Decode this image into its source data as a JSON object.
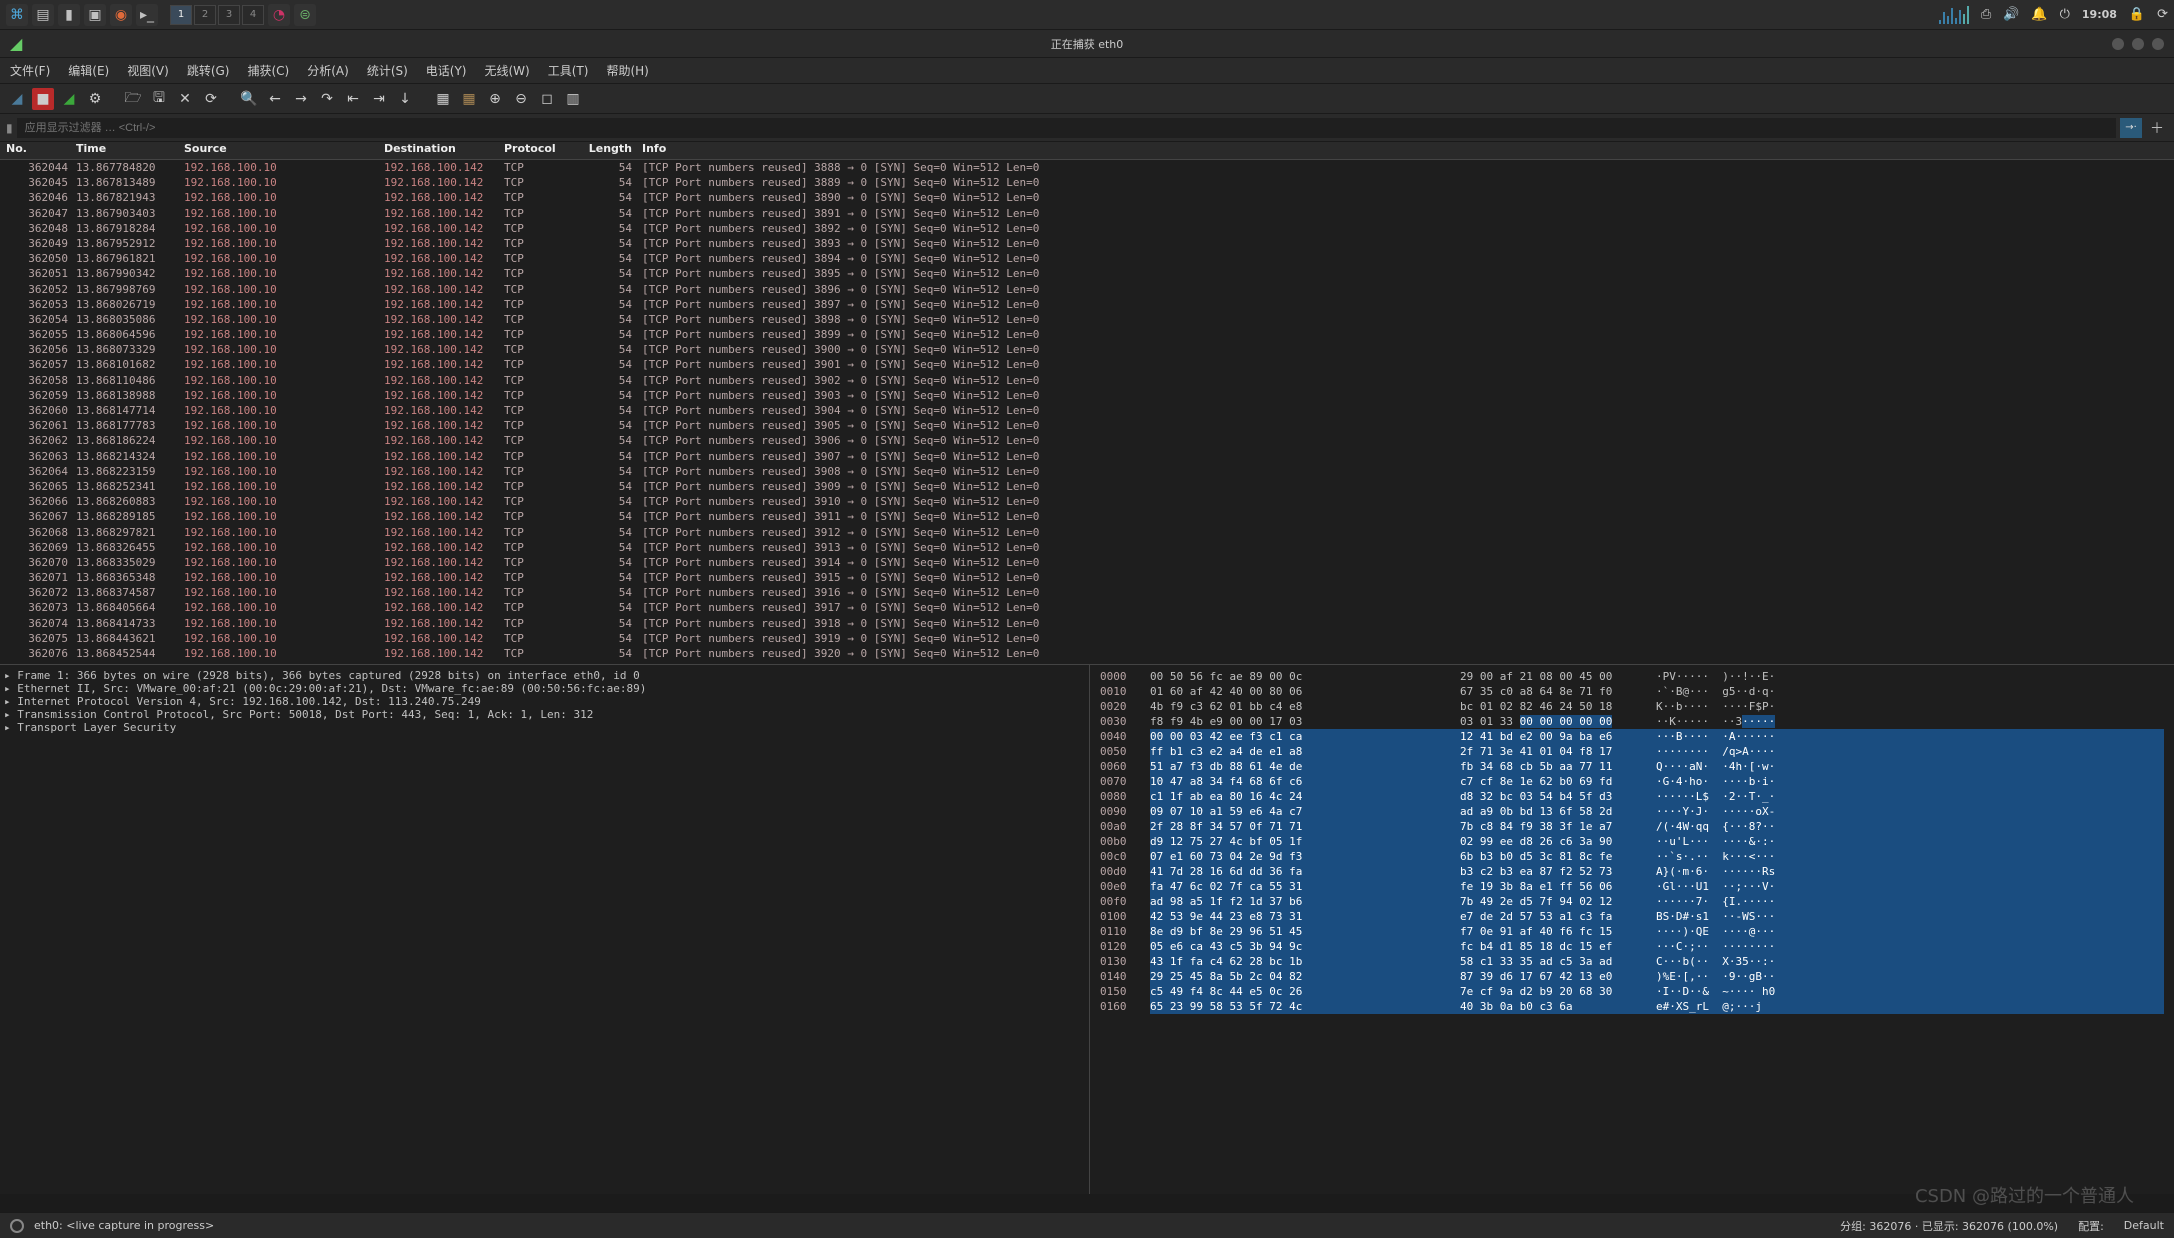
{
  "desktop": {
    "workspaces": [
      "1",
      "2",
      "3",
      "4"
    ],
    "active_workspace": 0,
    "clock": "19:08"
  },
  "window": {
    "title": "正在捕获 eth0"
  },
  "menu": {
    "file": "文件(F)",
    "edit": "编辑(E)",
    "view": "视图(V)",
    "go": "跳转(G)",
    "capture": "捕获(C)",
    "analyze": "分析(A)",
    "stats": "统计(S)",
    "telephony": "电话(Y)",
    "wireless": "无线(W)",
    "tools": "工具(T)",
    "help": "帮助(H)"
  },
  "filter": {
    "placeholder": "应用显示过滤器 … <Ctrl-/>"
  },
  "columns": {
    "no": "No.",
    "time": "Time",
    "source": "Source",
    "destination": "Destination",
    "protocol": "Protocol",
    "length": "Length",
    "info": "Info"
  },
  "packets": [
    {
      "no": "362044",
      "time": "13.867784820",
      "src": "192.168.100.10",
      "dst": "192.168.100.142",
      "proto": "TCP",
      "len": "54",
      "info": "[TCP Port numbers reused] 3888 → 0 [SYN] Seq=0 Win=512 Len=0"
    },
    {
      "no": "362045",
      "time": "13.867813489",
      "src": "192.168.100.10",
      "dst": "192.168.100.142",
      "proto": "TCP",
      "len": "54",
      "info": "[TCP Port numbers reused] 3889 → 0 [SYN] Seq=0 Win=512 Len=0"
    },
    {
      "no": "362046",
      "time": "13.867821943",
      "src": "192.168.100.10",
      "dst": "192.168.100.142",
      "proto": "TCP",
      "len": "54",
      "info": "[TCP Port numbers reused] 3890 → 0 [SYN] Seq=0 Win=512 Len=0"
    },
    {
      "no": "362047",
      "time": "13.867903403",
      "src": "192.168.100.10",
      "dst": "192.168.100.142",
      "proto": "TCP",
      "len": "54",
      "info": "[TCP Port numbers reused] 3891 → 0 [SYN] Seq=0 Win=512 Len=0"
    },
    {
      "no": "362048",
      "time": "13.867918284",
      "src": "192.168.100.10",
      "dst": "192.168.100.142",
      "proto": "TCP",
      "len": "54",
      "info": "[TCP Port numbers reused] 3892 → 0 [SYN] Seq=0 Win=512 Len=0"
    },
    {
      "no": "362049",
      "time": "13.867952912",
      "src": "192.168.100.10",
      "dst": "192.168.100.142",
      "proto": "TCP",
      "len": "54",
      "info": "[TCP Port numbers reused] 3893 → 0 [SYN] Seq=0 Win=512 Len=0"
    },
    {
      "no": "362050",
      "time": "13.867961821",
      "src": "192.168.100.10",
      "dst": "192.168.100.142",
      "proto": "TCP",
      "len": "54",
      "info": "[TCP Port numbers reused] 3894 → 0 [SYN] Seq=0 Win=512 Len=0"
    },
    {
      "no": "362051",
      "time": "13.867990342",
      "src": "192.168.100.10",
      "dst": "192.168.100.142",
      "proto": "TCP",
      "len": "54",
      "info": "[TCP Port numbers reused] 3895 → 0 [SYN] Seq=0 Win=512 Len=0"
    },
    {
      "no": "362052",
      "time": "13.867998769",
      "src": "192.168.100.10",
      "dst": "192.168.100.142",
      "proto": "TCP",
      "len": "54",
      "info": "[TCP Port numbers reused] 3896 → 0 [SYN] Seq=0 Win=512 Len=0"
    },
    {
      "no": "362053",
      "time": "13.868026719",
      "src": "192.168.100.10",
      "dst": "192.168.100.142",
      "proto": "TCP",
      "len": "54",
      "info": "[TCP Port numbers reused] 3897 → 0 [SYN] Seq=0 Win=512 Len=0"
    },
    {
      "no": "362054",
      "time": "13.868035086",
      "src": "192.168.100.10",
      "dst": "192.168.100.142",
      "proto": "TCP",
      "len": "54",
      "info": "[TCP Port numbers reused] 3898 → 0 [SYN] Seq=0 Win=512 Len=0"
    },
    {
      "no": "362055",
      "time": "13.868064596",
      "src": "192.168.100.10",
      "dst": "192.168.100.142",
      "proto": "TCP",
      "len": "54",
      "info": "[TCP Port numbers reused] 3899 → 0 [SYN] Seq=0 Win=512 Len=0"
    },
    {
      "no": "362056",
      "time": "13.868073329",
      "src": "192.168.100.10",
      "dst": "192.168.100.142",
      "proto": "TCP",
      "len": "54",
      "info": "[TCP Port numbers reused] 3900 → 0 [SYN] Seq=0 Win=512 Len=0"
    },
    {
      "no": "362057",
      "time": "13.868101682",
      "src": "192.168.100.10",
      "dst": "192.168.100.142",
      "proto": "TCP",
      "len": "54",
      "info": "[TCP Port numbers reused] 3901 → 0 [SYN] Seq=0 Win=512 Len=0"
    },
    {
      "no": "362058",
      "time": "13.868110486",
      "src": "192.168.100.10",
      "dst": "192.168.100.142",
      "proto": "TCP",
      "len": "54",
      "info": "[TCP Port numbers reused] 3902 → 0 [SYN] Seq=0 Win=512 Len=0"
    },
    {
      "no": "362059",
      "time": "13.868138988",
      "src": "192.168.100.10",
      "dst": "192.168.100.142",
      "proto": "TCP",
      "len": "54",
      "info": "[TCP Port numbers reused] 3903 → 0 [SYN] Seq=0 Win=512 Len=0"
    },
    {
      "no": "362060",
      "time": "13.868147714",
      "src": "192.168.100.10",
      "dst": "192.168.100.142",
      "proto": "TCP",
      "len": "54",
      "info": "[TCP Port numbers reused] 3904 → 0 [SYN] Seq=0 Win=512 Len=0"
    },
    {
      "no": "362061",
      "time": "13.868177783",
      "src": "192.168.100.10",
      "dst": "192.168.100.142",
      "proto": "TCP",
      "len": "54",
      "info": "[TCP Port numbers reused] 3905 → 0 [SYN] Seq=0 Win=512 Len=0"
    },
    {
      "no": "362062",
      "time": "13.868186224",
      "src": "192.168.100.10",
      "dst": "192.168.100.142",
      "proto": "TCP",
      "len": "54",
      "info": "[TCP Port numbers reused] 3906 → 0 [SYN] Seq=0 Win=512 Len=0"
    },
    {
      "no": "362063",
      "time": "13.868214324",
      "src": "192.168.100.10",
      "dst": "192.168.100.142",
      "proto": "TCP",
      "len": "54",
      "info": "[TCP Port numbers reused] 3907 → 0 [SYN] Seq=0 Win=512 Len=0"
    },
    {
      "no": "362064",
      "time": "13.868223159",
      "src": "192.168.100.10",
      "dst": "192.168.100.142",
      "proto": "TCP",
      "len": "54",
      "info": "[TCP Port numbers reused] 3908 → 0 [SYN] Seq=0 Win=512 Len=0"
    },
    {
      "no": "362065",
      "time": "13.868252341",
      "src": "192.168.100.10",
      "dst": "192.168.100.142",
      "proto": "TCP",
      "len": "54",
      "info": "[TCP Port numbers reused] 3909 → 0 [SYN] Seq=0 Win=512 Len=0"
    },
    {
      "no": "362066",
      "time": "13.868260883",
      "src": "192.168.100.10",
      "dst": "192.168.100.142",
      "proto": "TCP",
      "len": "54",
      "info": "[TCP Port numbers reused] 3910 → 0 [SYN] Seq=0 Win=512 Len=0"
    },
    {
      "no": "362067",
      "time": "13.868289185",
      "src": "192.168.100.10",
      "dst": "192.168.100.142",
      "proto": "TCP",
      "len": "54",
      "info": "[TCP Port numbers reused] 3911 → 0 [SYN] Seq=0 Win=512 Len=0"
    },
    {
      "no": "362068",
      "time": "13.868297821",
      "src": "192.168.100.10",
      "dst": "192.168.100.142",
      "proto": "TCP",
      "len": "54",
      "info": "[TCP Port numbers reused] 3912 → 0 [SYN] Seq=0 Win=512 Len=0"
    },
    {
      "no": "362069",
      "time": "13.868326455",
      "src": "192.168.100.10",
      "dst": "192.168.100.142",
      "proto": "TCP",
      "len": "54",
      "info": "[TCP Port numbers reused] 3913 → 0 [SYN] Seq=0 Win=512 Len=0"
    },
    {
      "no": "362070",
      "time": "13.868335029",
      "src": "192.168.100.10",
      "dst": "192.168.100.142",
      "proto": "TCP",
      "len": "54",
      "info": "[TCP Port numbers reused] 3914 → 0 [SYN] Seq=0 Win=512 Len=0"
    },
    {
      "no": "362071",
      "time": "13.868365348",
      "src": "192.168.100.10",
      "dst": "192.168.100.142",
      "proto": "TCP",
      "len": "54",
      "info": "[TCP Port numbers reused] 3915 → 0 [SYN] Seq=0 Win=512 Len=0"
    },
    {
      "no": "362072",
      "time": "13.868374587",
      "src": "192.168.100.10",
      "dst": "192.168.100.142",
      "proto": "TCP",
      "len": "54",
      "info": "[TCP Port numbers reused] 3916 → 0 [SYN] Seq=0 Win=512 Len=0"
    },
    {
      "no": "362073",
      "time": "13.868405664",
      "src": "192.168.100.10",
      "dst": "192.168.100.142",
      "proto": "TCP",
      "len": "54",
      "info": "[TCP Port numbers reused] 3917 → 0 [SYN] Seq=0 Win=512 Len=0"
    },
    {
      "no": "362074",
      "time": "13.868414733",
      "src": "192.168.100.10",
      "dst": "192.168.100.142",
      "proto": "TCP",
      "len": "54",
      "info": "[TCP Port numbers reused] 3918 → 0 [SYN] Seq=0 Win=512 Len=0"
    },
    {
      "no": "362075",
      "time": "13.868443621",
      "src": "192.168.100.10",
      "dst": "192.168.100.142",
      "proto": "TCP",
      "len": "54",
      "info": "[TCP Port numbers reused] 3919 → 0 [SYN] Seq=0 Win=512 Len=0"
    },
    {
      "no": "362076",
      "time": "13.868452544",
      "src": "192.168.100.10",
      "dst": "192.168.100.142",
      "proto": "TCP",
      "len": "54",
      "info": "[TCP Port numbers reused] 3920 → 0 [SYN] Seq=0 Win=512 Len=0"
    }
  ],
  "tree": [
    "▸ Frame 1: 366 bytes on wire (2928 bits), 366 bytes captured (2928 bits) on interface eth0, id 0",
    "▸ Ethernet II, Src: VMware_00:af:21 (00:0c:29:00:af:21), Dst: VMware_fc:ae:89 (00:50:56:fc:ae:89)",
    "▸ Internet Protocol Version 4, Src: 192.168.100.142, Dst: 113.240.75.249",
    "▸ Transmission Control Protocol, Src Port: 50018, Dst Port: 443, Seq: 1, Ack: 1, Len: 312",
    "▸ Transport Layer Security"
  ],
  "hex": [
    {
      "off": "0000",
      "b1": "00 50 56 fc ae 89 00 0c",
      "b2": "29 00 af 21 08 00 45 00",
      "asc": "·PV·····  )··!··E·",
      "sel": 0
    },
    {
      "off": "0010",
      "b1": "01 60 af 42 40 00 80 06",
      "b2": "67 35 c0 a8 64 8e 71 f0",
      "asc": "·`·B@···  g5··d·q·",
      "sel": 0
    },
    {
      "off": "0020",
      "b1": "4b f9 c3 62 01 bb c4 e8",
      "b2": "bc 01 02 82 46 24 50 18",
      "asc": "K··b····  ····F$P·",
      "sel": 0
    },
    {
      "off": "0030",
      "b1": "f8 f9 4b e9 00 00 17 03",
      "b2": "03 01 33 00 00 00 00 00",
      "asc": "··K·····  ··3·····",
      "sel": 1,
      "from": 10
    },
    {
      "off": "0040",
      "b1": "00 00 03 42 ee f3 c1 ca",
      "b2": "12 41 bd e2 00 9a ba e6",
      "asc": "···B····  ·A······",
      "sel": 2
    },
    {
      "off": "0050",
      "b1": "ff b1 c3 e2 a4 de e1 a8",
      "b2": "2f 71 3e 41 01 04 f8 17",
      "asc": "········  /q>A····",
      "sel": 2
    },
    {
      "off": "0060",
      "b1": "51 a7 f3 db 88 61 4e de",
      "b2": "fb 34 68 cb 5b aa 77 11",
      "asc": "Q····aN·  ·4h·[·w·",
      "sel": 2
    },
    {
      "off": "0070",
      "b1": "10 47 a8 34 f4 68 6f c6",
      "b2": "c7 cf 8e 1e 62 b0 69 fd",
      "asc": "·G·4·ho·  ····b·i·",
      "sel": 2
    },
    {
      "off": "0080",
      "b1": "c1 1f ab ea 80 16 4c 24",
      "b2": "d8 32 bc 03 54 b4 5f d3",
      "asc": "······L$  ·2··T·_·",
      "sel": 2
    },
    {
      "off": "0090",
      "b1": "09 07 10 a1 59 e6 4a c7",
      "b2": "ad a9 0b bd 13 6f 58 2d",
      "asc": "····Y·J·  ·····oX-",
      "sel": 2
    },
    {
      "off": "00a0",
      "b1": "2f 28 8f 34 57 0f 71 71",
      "b2": "7b c8 84 f9 38 3f 1e a7",
      "asc": "/(·4W·qq  {···8?··",
      "sel": 2
    },
    {
      "off": "00b0",
      "b1": "d9 12 75 27 4c bf 05 1f",
      "b2": "02 99 ee d8 26 c6 3a 90",
      "asc": "··u'L···  ····&·:·",
      "sel": 2
    },
    {
      "off": "00c0",
      "b1": "07 e1 60 73 04 2e 9d f3",
      "b2": "6b b3 b0 d5 3c 81 8c fe",
      "asc": "··`s·.··  k···<···",
      "sel": 2
    },
    {
      "off": "00d0",
      "b1": "41 7d 28 16 6d dd 36 fa",
      "b2": "b3 c2 b3 ea 87 f2 52 73",
      "asc": "A}(·m·6·  ······Rs",
      "sel": 2
    },
    {
      "off": "00e0",
      "b1": "fa 47 6c 02 7f ca 55 31",
      "b2": "fe 19 3b 8a e1 ff 56 06",
      "asc": "·Gl···U1  ··;···V·",
      "sel": 2
    },
    {
      "off": "00f0",
      "b1": "ad 98 a5 1f f2 1d 37 b6",
      "b2": "7b 49 2e d5 7f 94 02 12",
      "asc": "······7·  {I.·····",
      "sel": 2
    },
    {
      "off": "0100",
      "b1": "42 53 9e 44 23 e8 73 31",
      "b2": "e7 de 2d 57 53 a1 c3 fa",
      "asc": "BS·D#·s1  ··-WS···",
      "sel": 2
    },
    {
      "off": "0110",
      "b1": "8e d9 bf 8e 29 96 51 45",
      "b2": "f7 0e 91 af 40 f6 fc 15",
      "asc": "····)·QE  ····@···",
      "sel": 2
    },
    {
      "off": "0120",
      "b1": "05 e6 ca 43 c5 3b 94 9c",
      "b2": "fc b4 d1 85 18 dc 15 ef",
      "asc": "···C·;··  ········",
      "sel": 2
    },
    {
      "off": "0130",
      "b1": "43 1f fa c4 62 28 bc 1b",
      "b2": "58 c1 33 35 ad c5 3a ad",
      "asc": "C···b(··  X·35··:·",
      "sel": 2
    },
    {
      "off": "0140",
      "b1": "29 25 45 8a 5b 2c 04 82",
      "b2": "87 39 d6 17 67 42 13 e0",
      "asc": ")%E·[,··  ·9··gB··",
      "sel": 2
    },
    {
      "off": "0150",
      "b1": "c5 49 f4 8c 44 e5 0c 26",
      "b2": "7e cf 9a d2 b9 20 68 30",
      "asc": "·I··D··&  ~···· h0",
      "sel": 2
    },
    {
      "off": "0160",
      "b1": "65 23 99 58 53 5f 72 4c",
      "b2": "40 3b 0a b0 c3 6a",
      "asc": "e#·XS_rL  @;···j",
      "sel": 2
    }
  ],
  "statusbar": {
    "left_dot": "",
    "interface": "eth0: <live capture in progress>",
    "packets": "分组: 362076 · 已显示: 362076 (100.0%)",
    "profile_label": "配置:",
    "profile_value": "Default"
  },
  "watermark": "CSDN @路过的一个普通人"
}
